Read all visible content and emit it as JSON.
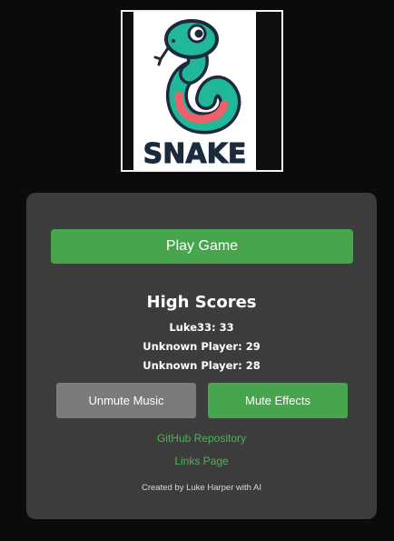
{
  "logo": {
    "wordmark": "SNAKE",
    "colors": {
      "body": "#21b89a",
      "belly": "#f0606a",
      "outline": "#1c2a3e",
      "tongue": "#1c2a3e"
    }
  },
  "menu": {
    "play_label": "Play Game",
    "high_scores_title": "High Scores",
    "high_scores": [
      "Luke33: 33",
      "Unknown Player: 29",
      "Unknown Player: 28"
    ],
    "music_button_label": "Unmute Music",
    "effects_button_label": "Mute Effects",
    "links": {
      "github": "GitHub Repository",
      "links_page": "Links Page"
    },
    "credit": "Created by Luke Harper with AI"
  },
  "colors": {
    "background": "#0b0b0b",
    "panel": "#3c3c3c",
    "accent_green": "#46a54d",
    "link_green": "#4db456",
    "muted_button": "#7b7b7b"
  }
}
